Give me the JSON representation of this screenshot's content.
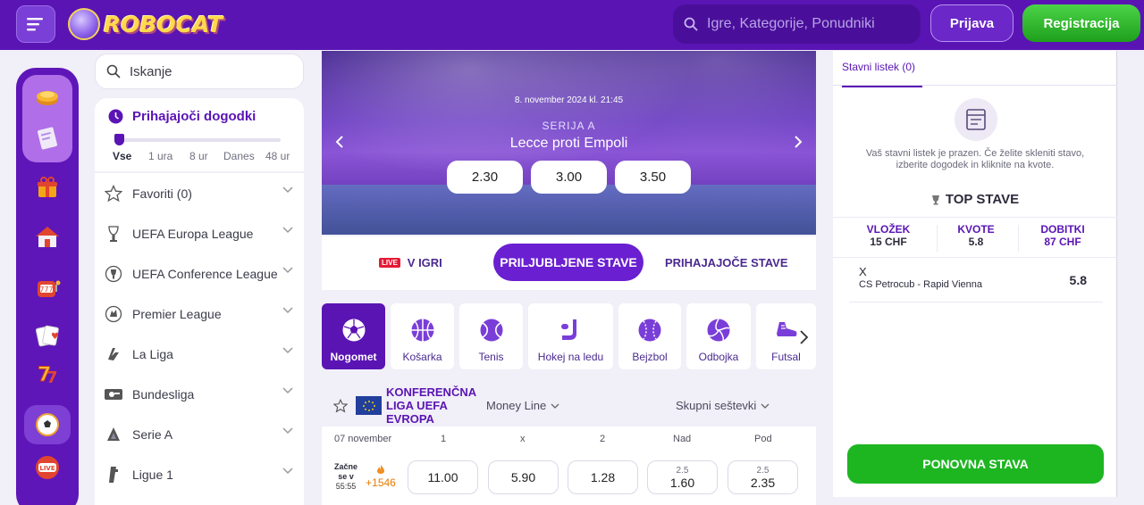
{
  "header": {
    "logo_text": "ROBOCAT",
    "search_placeholder": "Igre, Kategorije, Ponudniki",
    "login_label": "Prijava",
    "register_label": "Registracija"
  },
  "sidebar_search": {
    "placeholder": "Iskanje"
  },
  "upcoming": {
    "title": "Prihajajoči dogodki",
    "time_options": [
      "Vse",
      "1 ura",
      "8 ur",
      "Danes",
      "48 ur"
    ],
    "selected": "Vse"
  },
  "leagues": [
    {
      "name": "Favoriti (0)",
      "icon": "star-icon"
    },
    {
      "name": "UEFA Europa League",
      "icon": "europa-league-icon"
    },
    {
      "name": "UEFA Conference League",
      "icon": "conference-league-icon"
    },
    {
      "name": "Premier League",
      "icon": "premier-league-icon"
    },
    {
      "name": "La Liga",
      "icon": "la-liga-icon"
    },
    {
      "name": "Bundesliga",
      "icon": "bundesliga-icon"
    },
    {
      "name": "Serie A",
      "icon": "serie-a-icon"
    },
    {
      "name": "Ligue 1",
      "icon": "ligue-1-icon"
    }
  ],
  "hero": {
    "date": "8. november 2024 kl. 21:45",
    "league": "SERIJA A",
    "match": "Lecce  proti  Empoli",
    "odds": [
      "2.30",
      "3.00",
      "3.50"
    ]
  },
  "tabs": {
    "live_badge": "LIVE",
    "live_label": "V IGRI",
    "favorites_label": "PRILJUBLJENE STAVE",
    "upcoming_label": "PRIHAJAJOČE STAVE"
  },
  "sports": [
    {
      "label": "Nogomet",
      "icon": "soccer-ball-icon"
    },
    {
      "label": "Košarka",
      "icon": "basketball-icon"
    },
    {
      "label": "Tenis",
      "icon": "tennis-ball-icon"
    },
    {
      "label": "Hokej na ledu",
      "icon": "hockey-stick-icon"
    },
    {
      "label": "Bejzbol",
      "icon": "baseball-icon"
    },
    {
      "label": "Odbojka",
      "icon": "volleyball-icon"
    },
    {
      "label": "Futsal",
      "icon": "futsal-shoe-icon"
    }
  ],
  "competition": {
    "name": "KONFERENČNA LIGA UEFA EVROPA",
    "market_select": "Money Line",
    "totals_select": "Skupni seštevki",
    "date_header": "07 november",
    "columns": [
      "1",
      "x",
      "2",
      "Nad",
      "Pod"
    ]
  },
  "event": {
    "starts_label": "Začne se v",
    "starts_time": "55:55",
    "more_count": "+1546",
    "odds": [
      {
        "line": "",
        "value": "11.00"
      },
      {
        "line": "",
        "value": "5.90"
      },
      {
        "line": "",
        "value": "1.28"
      },
      {
        "line": "2.5",
        "value": "1.60"
      },
      {
        "line": "2.5",
        "value": "2.35"
      }
    ]
  },
  "betslip": {
    "tab_label": "Stavni listek (0)",
    "empty_text": "Vaš stavni listek je prazen. Če želite skleniti stavo, izberite dogodek in kliknite na kvote.",
    "top_title": "TOP STAVE",
    "stake_label": "VLOŽEK",
    "stake_value": "15 CHF",
    "odds_label": "KVOTE",
    "odds_value": "5.8",
    "win_label": "DOBITKI",
    "win_value": "87 CHF",
    "pick": "X",
    "event": "CS Petrocub - Rapid Vienna",
    "pick_odds": "5.8",
    "replay_label": "PONOVNA STAVA"
  },
  "colors": {
    "brand_purple": "#5a14b4",
    "green": "#1db621",
    "live_red": "#e51a35"
  }
}
